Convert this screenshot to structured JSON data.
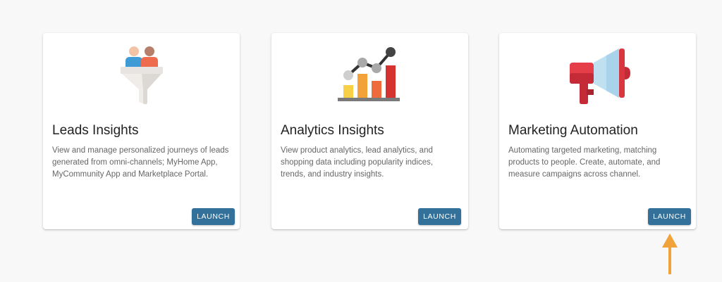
{
  "cards": [
    {
      "title": "Leads Insights",
      "description": "View and manage personalized journeys of leads generated from omni-channels; MyHome App, MyCommunity App and Marketplace Portal.",
      "button_label": "LAUNCH",
      "icon": "funnel-people-icon"
    },
    {
      "title": "Analytics Insights",
      "description": "View product analytics, lead analytics, and shopping data including popularity indices, trends, and industry insights.",
      "button_label": "LAUNCH",
      "icon": "bar-chart-icon"
    },
    {
      "title": "Marketing Automation",
      "description": "Automating targeted marketing, matching products to people. Create, automate, and measure campaigns across channel.",
      "button_label": "LAUNCH",
      "icon": "megaphone-icon"
    }
  ],
  "colors": {
    "button": "#33719a",
    "arrow": "#f0a33a",
    "background": "#f8f8f8"
  }
}
